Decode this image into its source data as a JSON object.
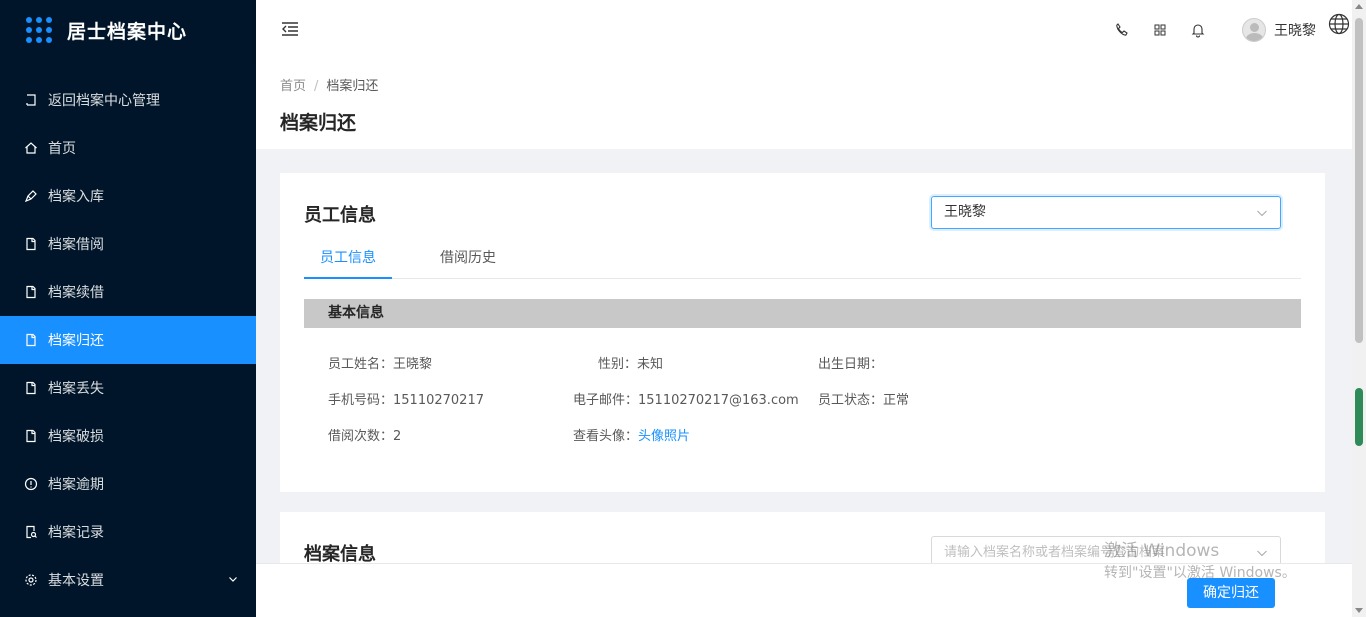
{
  "app": {
    "title": "居士档案中心"
  },
  "sidebar": {
    "items": [
      {
        "label": "返回档案中心管理",
        "icon": "return-icon"
      },
      {
        "label": "首页",
        "icon": "home-icon"
      },
      {
        "label": "档案入库",
        "icon": "pen-icon"
      },
      {
        "label": "档案借阅",
        "icon": "file-icon"
      },
      {
        "label": "档案续借",
        "icon": "file-icon"
      },
      {
        "label": "档案归还",
        "icon": "file-icon",
        "active": true
      },
      {
        "label": "档案丢失",
        "icon": "file-icon"
      },
      {
        "label": "档案破损",
        "icon": "file-icon"
      },
      {
        "label": "档案逾期",
        "icon": "exclamation-circle-icon"
      },
      {
        "label": "档案记录",
        "icon": "file-search-icon"
      },
      {
        "label": "基本设置",
        "icon": "gear-icon"
      }
    ]
  },
  "header": {
    "username": "王晓黎"
  },
  "breadcrumb": {
    "home": "首页",
    "sep": "/",
    "current": "档案归还"
  },
  "page": {
    "title": "档案归还"
  },
  "employee_card": {
    "title": "员工信息",
    "select_value": "王晓黎",
    "tabs": [
      "员工信息",
      "借阅历史"
    ],
    "section_title": "基本信息",
    "fields": {
      "name_label": "员工姓名：",
      "name_value": "王晓黎",
      "gender_label": "性别：",
      "gender_value": "未知",
      "birth_label": "出生日期：",
      "birth_value": "",
      "phone_label": "手机号码：",
      "phone_value": "15110270217",
      "email_label": "电子邮件：",
      "email_value": "15110270217@163.com",
      "status_label": "员工状态：",
      "status_value": "正常",
      "borrow_label": "借阅次数：",
      "borrow_value": "2",
      "avatar_label": "查看头像：",
      "avatar_link": "头像照片"
    }
  },
  "archive_card": {
    "title": "档案信息",
    "search_placeholder": "请输入档案名称或者档案编号查询档案"
  },
  "footer": {
    "confirm_label": "确定归还"
  },
  "watermark": {
    "line1": "激活 Windows",
    "line2": "转到\"设置\"以激活 Windows。"
  },
  "colors": {
    "sidebar_bg": "#001529",
    "primary": "#1890ff",
    "section_bg": "#c8c8c8"
  }
}
